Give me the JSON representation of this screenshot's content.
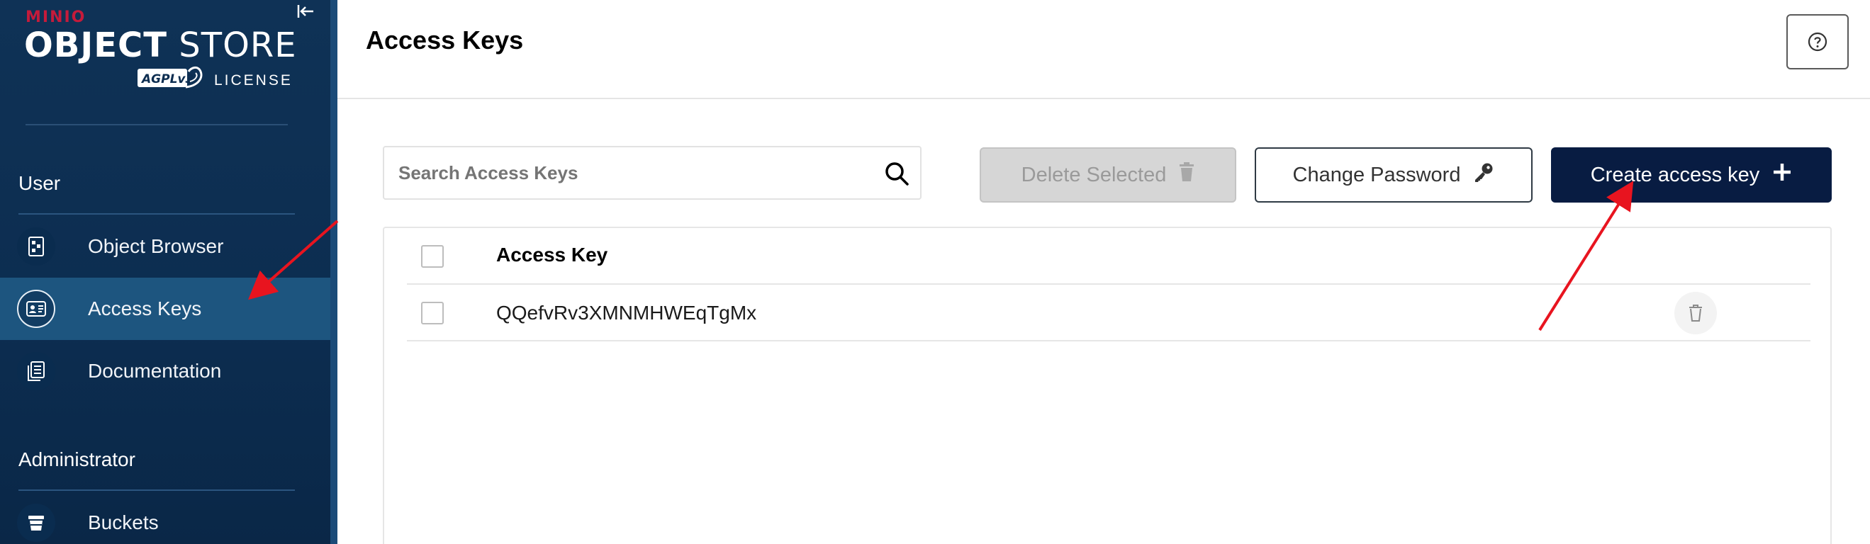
{
  "app": {
    "brand_top": "MINIO",
    "brand_main_bold": "OBJECT",
    "brand_main_light": " STORE",
    "license_badge": "AGPLv3",
    "license_label": "LICENSE"
  },
  "sidebar": {
    "sections": [
      {
        "label": "User",
        "items": [
          {
            "label": "Object Browser",
            "icon": "object-browser-icon",
            "active": false
          },
          {
            "label": "Access Keys",
            "icon": "access-keys-icon",
            "active": true
          },
          {
            "label": "Documentation",
            "icon": "documentation-icon",
            "active": false
          }
        ]
      },
      {
        "label": "Administrator",
        "items": [
          {
            "label": "Buckets",
            "icon": "buckets-icon",
            "active": false
          }
        ]
      }
    ]
  },
  "header": {
    "title": "Access Keys"
  },
  "toolbar": {
    "search_placeholder": "Search Access Keys",
    "delete_selected_label": "Delete Selected",
    "change_password_label": "Change Password",
    "create_access_key_label": "Create access key"
  },
  "table": {
    "columns": [
      "Access Key"
    ],
    "rows": [
      {
        "access_key": "QQefvRv3XMNMHWEqTgMx"
      }
    ]
  },
  "colors": {
    "sidebar_bg": "#0c2d50",
    "active_item_bg": "#1d557f",
    "primary_button_bg": "#081c42",
    "annotation_arrow": "#e8141f"
  }
}
